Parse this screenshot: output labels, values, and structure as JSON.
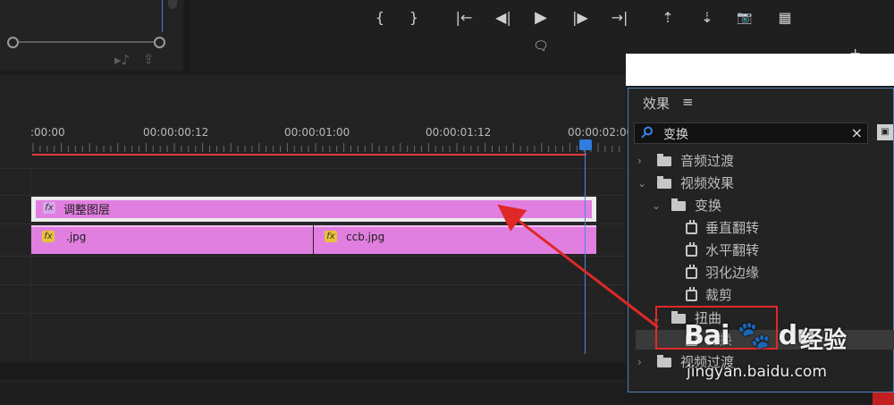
{
  "transport": {
    "buttons": [
      {
        "name": "mark-in-icon",
        "glyph": "{"
      },
      {
        "name": "mark-out-icon",
        "glyph": "}"
      },
      {
        "name": "go-to-in-icon",
        "glyph": "|←"
      },
      {
        "name": "step-back-icon",
        "glyph": "◀|"
      },
      {
        "name": "play-icon",
        "glyph": "▶"
      },
      {
        "name": "step-forward-icon",
        "glyph": "|▶"
      },
      {
        "name": "go-to-out-icon",
        "glyph": "→|"
      },
      {
        "name": "lift-icon",
        "glyph": "⇡"
      },
      {
        "name": "extract-icon",
        "glyph": "⇣"
      },
      {
        "name": "export-frame-icon",
        "glyph": "📷"
      },
      {
        "name": "comparison-view-icon",
        "glyph": "▦"
      }
    ],
    "caption_icon": "comment-icon"
  },
  "timeline": {
    "timecodes": [
      ":00:00",
      "00:00:00:12",
      "00:00:01:00",
      "00:00:01:12",
      "00:00:02:00"
    ],
    "clips": {
      "adjustment_layer": {
        "fx": "fx",
        "label": "调整图层"
      },
      "clip1": {
        "fx": "fx",
        "label": ".jpg"
      },
      "clip2": {
        "fx": "fx",
        "label": "ccb.jpg"
      }
    },
    "colors": {
      "clip": "#e07fe0",
      "playhead": "#2f7de0",
      "work_area": "#e03a3a"
    }
  },
  "effects_panel": {
    "title": "效果",
    "menu_icon": "≡",
    "search": {
      "value": "变换",
      "clear": "×"
    },
    "tree": [
      {
        "label": "音频过渡",
        "type": "folder",
        "chevron": "›"
      },
      {
        "label": "视频效果",
        "type": "folder",
        "chevron": "⌄"
      },
      {
        "label": "变换",
        "type": "folder",
        "chevron": "⌄"
      },
      {
        "label": "垂直翻转",
        "type": "effect"
      },
      {
        "label": "水平翻转",
        "type": "effect"
      },
      {
        "label": "羽化边缘",
        "type": "effect"
      },
      {
        "label": "裁剪",
        "type": "effect"
      },
      {
        "label": "扭曲",
        "type": "folder",
        "chevron": "⌄"
      },
      {
        "label": "变换",
        "type": "effect"
      },
      {
        "label": "视频过渡",
        "type": "folder",
        "chevron": "›"
      }
    ]
  },
  "watermark": {
    "brand": "Bai 🐾 du",
    "sub": "经验",
    "url": "jingyan.baidu.com"
  }
}
